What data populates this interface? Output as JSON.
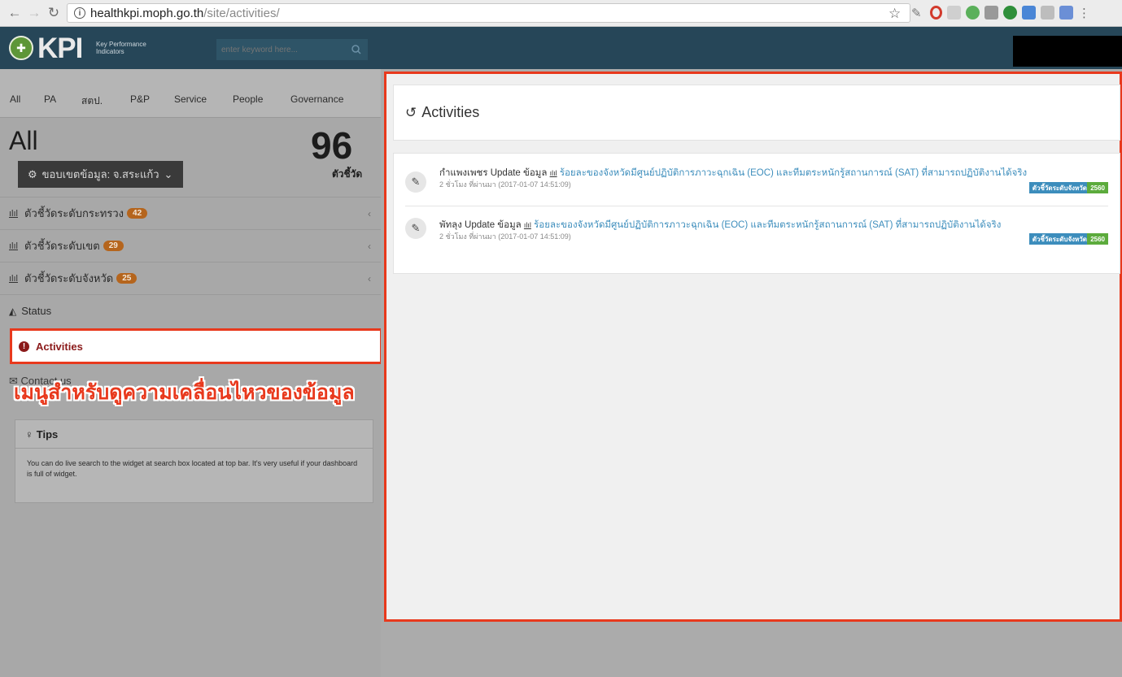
{
  "browser": {
    "url_host": "healthkpi.moph.go.th",
    "url_path": "/site/activities/"
  },
  "header": {
    "logo_text": "KPI",
    "logo_sub": "Key Performance Indicators",
    "search_placeholder": "enter keyword here..."
  },
  "sidebar": {
    "tabs": [
      "All",
      "PA",
      "สตป.",
      "P&P",
      "Service",
      "People",
      "Governance"
    ],
    "title": "All",
    "count": "96",
    "count_label": "ตัวชี้วัด",
    "scope_button": "ขอบเขตข้อมูล: จ.สระแก้ว",
    "menu": [
      {
        "label": "ตัวชี้วัดระดับกระทรวง",
        "badge": "42"
      },
      {
        "label": "ตัวชี้วัดระดับเขต",
        "badge": "29"
      },
      {
        "label": "ตัวชี้วัดระดับจังหวัด",
        "badge": "25"
      },
      {
        "label": "Status"
      },
      {
        "label": "Activities"
      },
      {
        "label": "Contact us"
      }
    ],
    "annotation": "เมนูสำหรับดูความเคลื่อนไหวของข้อมูล",
    "tips": {
      "title": "Tips",
      "body": "You can do live search to the widget at search box located at top bar. It's very useful if your dashboard is full of widget."
    }
  },
  "main": {
    "title": "Activities",
    "activities": [
      {
        "province": "กำแพงเพชร",
        "action": "Update ข้อมูล",
        "indicator": "ร้อยละของจังหวัดมีศูนย์ปฏิบัติการภาวะฉุกเฉิน (EOC) และทีมตระหนักรู้สถานการณ์ (SAT) ที่สามารถปฏิบัติงานได้จริง",
        "time": "2 ชั่วโมง ที่ผ่านมา (2017-01-07 14:51:09)",
        "level_tag": "ตัวชี้วัดระดับจังหวัด",
        "year_tag": "2560"
      },
      {
        "province": "พัทลุง",
        "action": "Update ข้อมูล",
        "indicator": "ร้อยละของจังหวัดมีศูนย์ปฏิบัติการภาวะฉุกเฉิน (EOC) และทีมตระหนักรู้สถานการณ์ (SAT) ที่สามารถปฏิบัติงานได้จริง",
        "time": "2 ชั่วโมง ที่ผ่านมา (2017-01-07 14:51:09)",
        "level_tag": "ตัวชี้วัดระดับจังหวัด",
        "year_tag": "2560"
      }
    ]
  },
  "colors": {
    "header_bg": "#264658",
    "highlight": "#e8391d",
    "link": "#3c8dbc",
    "badge": "#b5651d",
    "year_tag": "#5cab3c"
  }
}
